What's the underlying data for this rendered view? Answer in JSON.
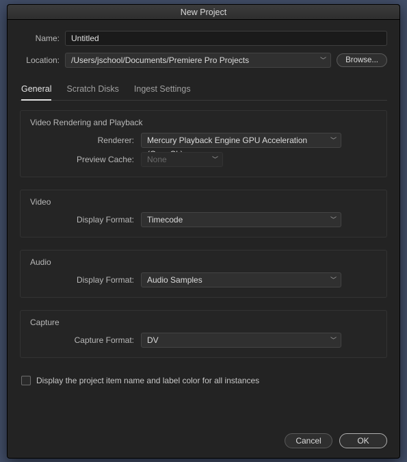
{
  "title": "New Project",
  "fields": {
    "name_label": "Name:",
    "name_value": "Untitled",
    "location_label": "Location:",
    "location_value": "/Users/jschool/Documents/Premiere Pro Projects",
    "browse_label": "Browse..."
  },
  "tabs": {
    "general": "General",
    "scratch": "Scratch Disks",
    "ingest": "Ingest Settings"
  },
  "sections": {
    "video_render": {
      "title": "Video Rendering and Playback",
      "renderer_label": "Renderer:",
      "renderer_value": "Mercury Playback Engine GPU Acceleration (OpenCL)",
      "preview_cache_label": "Preview Cache:",
      "preview_cache_value": "None"
    },
    "video": {
      "title": "Video",
      "display_format_label": "Display Format:",
      "display_format_value": "Timecode"
    },
    "audio": {
      "title": "Audio",
      "display_format_label": "Display Format:",
      "display_format_value": "Audio Samples"
    },
    "capture": {
      "title": "Capture",
      "capture_format_label": "Capture Format:",
      "capture_format_value": "DV"
    }
  },
  "checkbox": {
    "label": "Display the project item name and label color for all instances",
    "checked": false
  },
  "footer": {
    "cancel": "Cancel",
    "ok": "OK"
  }
}
